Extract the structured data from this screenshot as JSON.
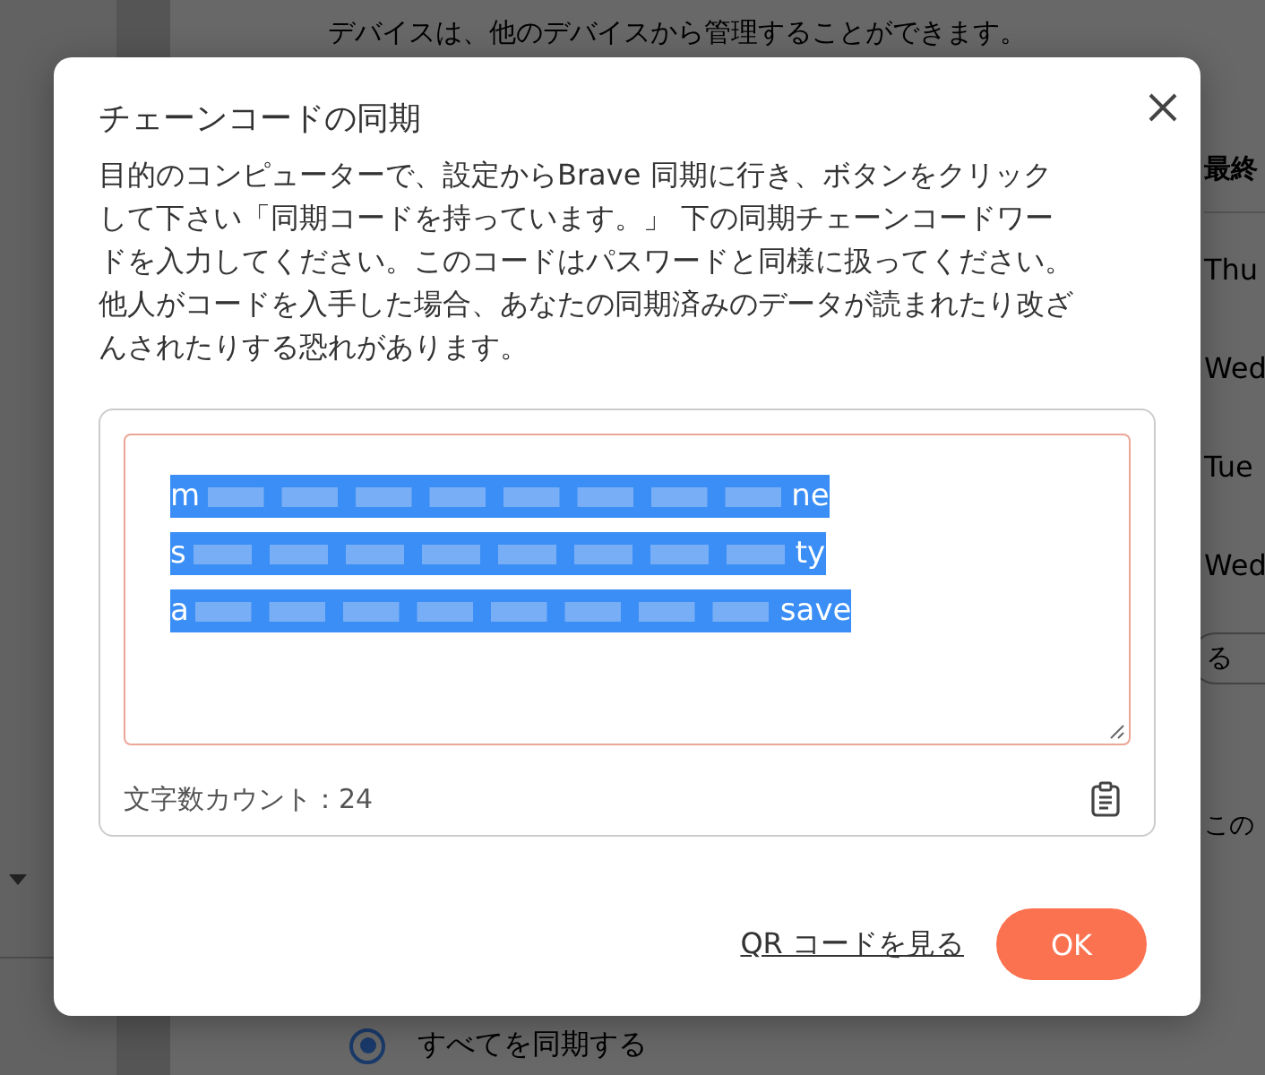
{
  "background": {
    "intro_lines": [
      "デバイスは、他のデバイスから管理することができます。"
    ],
    "column_header": "最終",
    "dates": [
      "Thu",
      "Wed",
      "Tue",
      "Wed"
    ],
    "button_fragment": "る",
    "side_text": "この",
    "sync_option": {
      "label": "すべてを同期する",
      "selected": true
    }
  },
  "dialog": {
    "title": "チェーンコードの同期",
    "description": "目的のコンピューターで、設定からBrave 同期に行き、ボタンをクリックして下さい「同期コードを持っています。」 下の同期チェーンコードワードを入力してください。このコードはパスワードと同様に扱ってください。他人がコードを入手した場合、あなたの同期済みのデータが読まれたり改ざんされたりする恐れがあります。",
    "code_lines": [
      {
        "start": "m",
        "end": "ne"
      },
      {
        "start": "s",
        "end": "ty"
      },
      {
        "start": "a",
        "end": "save"
      }
    ],
    "word_count": "文字数カウント：24",
    "qr_link": "QR コードを見る",
    "ok_button": "OK"
  }
}
